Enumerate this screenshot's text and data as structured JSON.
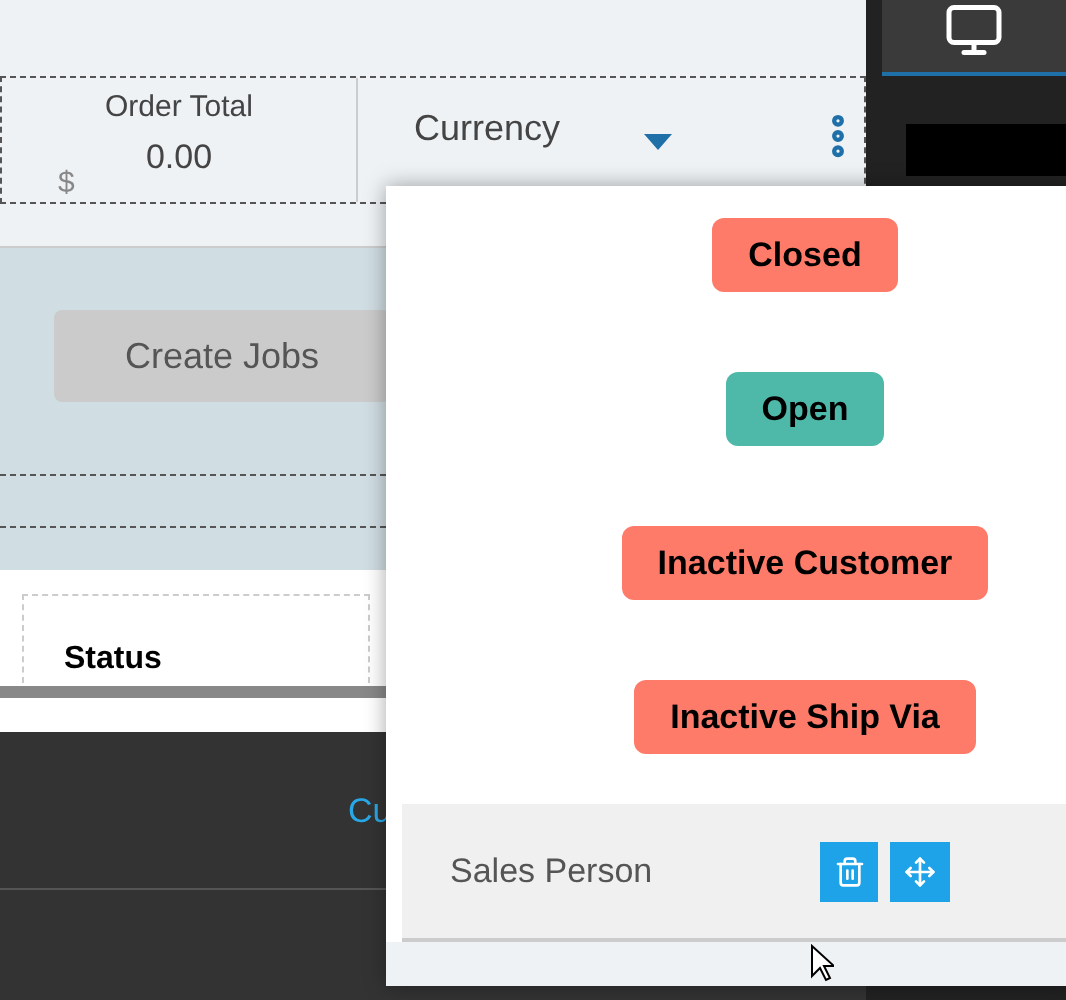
{
  "order_total": {
    "label": "Order Total",
    "value": "0.00",
    "currency_symbol": "$"
  },
  "currency": {
    "label": "Currency"
  },
  "create_jobs_button": "Create Jobs",
  "status_label": "Status",
  "bottom_link": "Cu",
  "popup": {
    "badges": [
      {
        "label": "Closed",
        "color": "#fe7b6a"
      },
      {
        "label": "Open",
        "color": "#4fb9a9"
      },
      {
        "label": "Inactive Customer",
        "color": "#fe7b6a"
      },
      {
        "label": "Inactive Ship Via",
        "color": "#fe7b6a"
      }
    ],
    "field": {
      "label": "Sales Person"
    }
  }
}
